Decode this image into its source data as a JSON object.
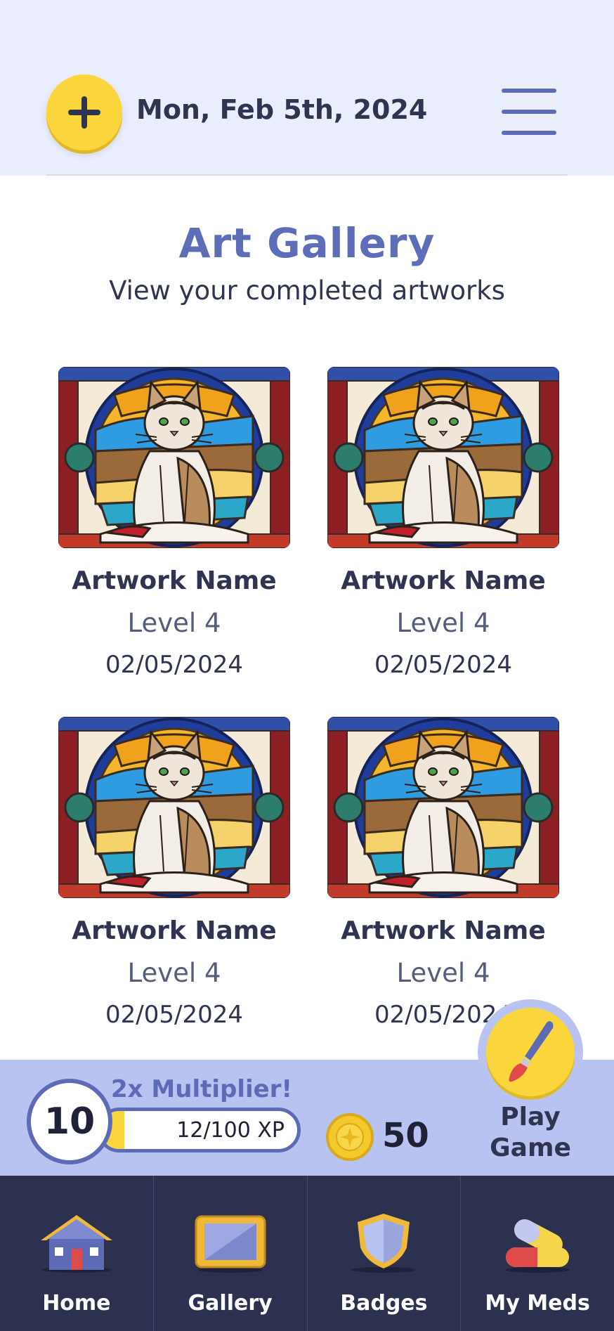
{
  "header": {
    "date": "Mon, Feb 5th, 2024"
  },
  "gallery": {
    "title": "Art Gallery",
    "subtitle": "View your completed artworks",
    "artworks": [
      {
        "name": "Artwork Name",
        "level": "Level 4",
        "date": "02/05/2024"
      },
      {
        "name": "Artwork Name",
        "level": "Level 4",
        "date": "02/05/2024"
      },
      {
        "name": "Artwork Name",
        "level": "Level 4",
        "date": "02/05/2024"
      },
      {
        "name": "Artwork Name",
        "level": "Level 4",
        "date": "02/05/2024"
      }
    ]
  },
  "progress": {
    "level": "10",
    "multiplier": "2x Multiplier!",
    "xp_text": "12/100 XP",
    "xp_fraction": 0.12,
    "coins": "50",
    "play_label": "Play\nGame"
  },
  "nav": {
    "items": [
      {
        "label": "Home",
        "icon": "house-icon"
      },
      {
        "label": "Gallery",
        "icon": "picture-frame-icon"
      },
      {
        "label": "Badges",
        "icon": "shield-badge-icon"
      },
      {
        "label": "My Meds",
        "icon": "pill-capsule-icon"
      }
    ]
  },
  "colors": {
    "header_bg": "#eaeefc",
    "accent_yellow": "#fad53c",
    "brand_blue": "#5d6db8",
    "xp_bar_bg": "#b9c3f2",
    "nav_bg": "#2c3150"
  }
}
